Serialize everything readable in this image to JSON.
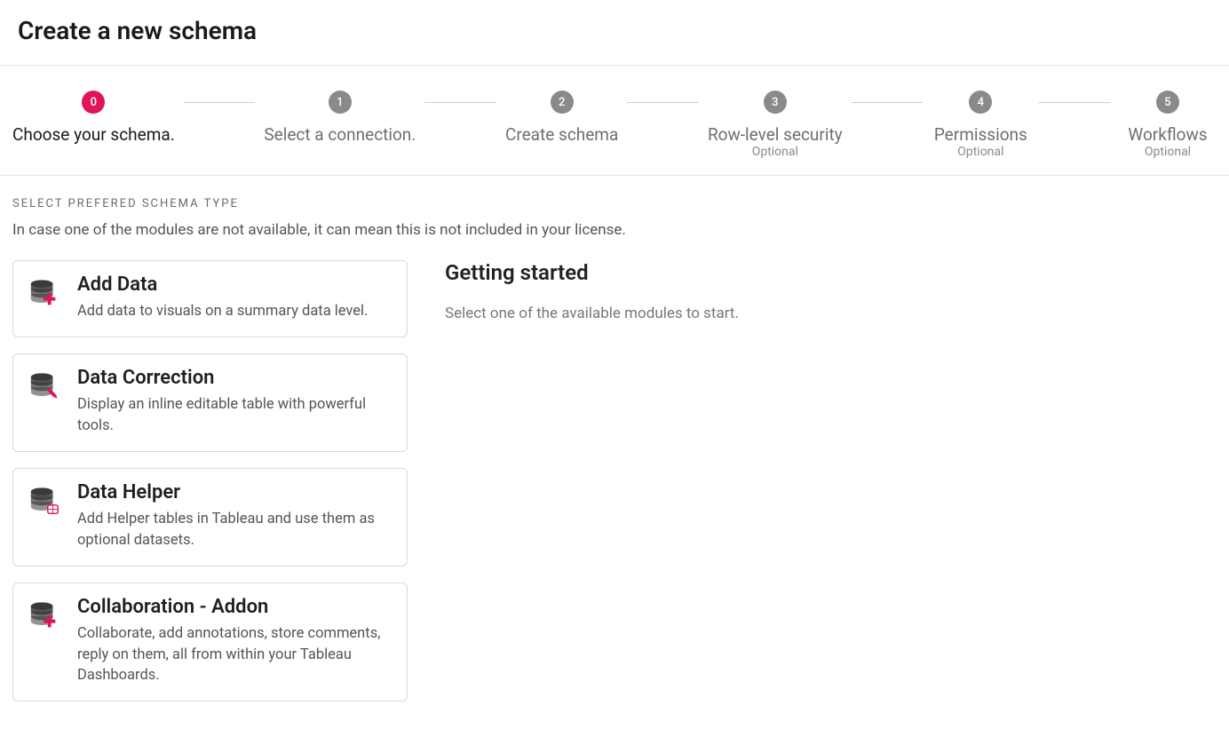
{
  "page": {
    "title": "Create a new schema"
  },
  "stepper": {
    "steps": [
      {
        "num": "0",
        "label": "Choose your schema.",
        "sub": "",
        "active": true
      },
      {
        "num": "1",
        "label": "Select a connection.",
        "sub": "",
        "active": false
      },
      {
        "num": "2",
        "label": "Create schema",
        "sub": "",
        "active": false
      },
      {
        "num": "3",
        "label": "Row-level security",
        "sub": "Optional",
        "active": false
      },
      {
        "num": "4",
        "label": "Permissions",
        "sub": "Optional",
        "active": false
      },
      {
        "num": "5",
        "label": "Workflows",
        "sub": "Optional",
        "active": false
      }
    ]
  },
  "section": {
    "label": "Select Prefered Schema Type",
    "desc": "In case one of the modules are not available, it can mean this is not included in your license."
  },
  "cards": [
    {
      "id": "add-data",
      "icon": "database-plus-icon",
      "title": "Add Data",
      "desc": "Add data to visuals on a summary data level."
    },
    {
      "id": "data-correction",
      "icon": "database-edit-icon",
      "title": "Data Correction",
      "desc": "Display an inline editable table with powerful tools."
    },
    {
      "id": "data-helper",
      "icon": "database-helper-icon",
      "title": "Data Helper",
      "desc": "Add Helper tables in Tableau and use them as optional datasets."
    },
    {
      "id": "collaboration-addon",
      "icon": "database-plus-icon",
      "title": "Collaboration - Addon",
      "desc": "Collaborate, add annotations, store comments, reply on them, all from within your Tableau Dashboards."
    }
  ],
  "side": {
    "title": "Getting started",
    "desc": "Select one of the available modules to start."
  }
}
